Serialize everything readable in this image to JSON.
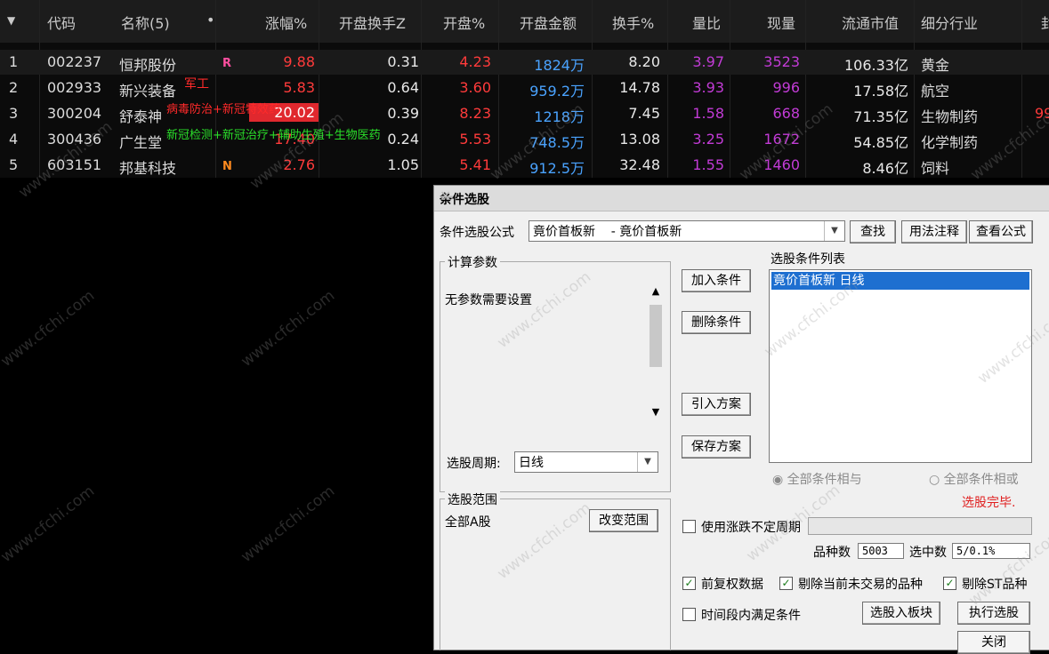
{
  "header": {
    "sort_icon": "▼",
    "cols": [
      "代码",
      "名称(5)",
      "•",
      "涨幅%",
      "开盘换手Z",
      "开盘%",
      "开盘金额",
      "换手%",
      "量比",
      "现量",
      "流通市值",
      "细分行业",
      "封"
    ]
  },
  "rows": [
    {
      "idx": "1",
      "code": "002237",
      "name": "恒邦股份",
      "tag": "R",
      "chg": "9.88",
      "open_turn": "0.31",
      "open_pct": "4.23",
      "open_amt": "1824万",
      "turn": "8.20",
      "vol_ratio": "3.97",
      "cur_vol": "3523",
      "mcap": "106.33亿",
      "industry": "黄金"
    },
    {
      "idx": "2",
      "code": "002933",
      "name": "新兴装备",
      "tag": "",
      "chg": "5.83",
      "open_turn": "0.64",
      "open_pct": "3.60",
      "open_amt": "959.2万",
      "turn": "14.78",
      "vol_ratio": "3.93",
      "cur_vol": "996",
      "mcap": "17.58亿",
      "industry": "航空"
    },
    {
      "idx": "3",
      "code": "300204",
      "name": "舒泰神",
      "tag": "",
      "chg": "20.02",
      "open_turn": "0.39",
      "open_pct": "8.23",
      "open_amt": "1218万",
      "turn": "7.45",
      "vol_ratio": "1.58",
      "cur_vol": "668",
      "mcap": "71.35亿",
      "industry": "生物制药",
      "extra": "99"
    },
    {
      "idx": "4",
      "code": "300436",
      "name": "广生堂",
      "tag": "",
      "chg": "17.40",
      "open_turn": "0.24",
      "open_pct": "5.53",
      "open_amt": "748.5万",
      "turn": "13.08",
      "vol_ratio": "3.25",
      "cur_vol": "1672",
      "mcap": "54.85亿",
      "industry": "化学制药"
    },
    {
      "idx": "5",
      "code": "603151",
      "name": "邦基科技",
      "tag": "N",
      "chg": "2.76",
      "open_turn": "1.05",
      "open_pct": "5.41",
      "open_amt": "912.5万",
      "turn": "32.48",
      "vol_ratio": "1.55",
      "cur_vol": "1460",
      "mcap": "8.46亿",
      "industry": "饲料"
    }
  ],
  "overlays": {
    "tag_junggong": "军工",
    "tag_virus": "病毒防治+新冠特效药",
    "tag_covid": "新冠检测+新冠治疗+辅助生殖+生物医药"
  },
  "dialog": {
    "title": "条件选股",
    "formula_label": "条件选股公式",
    "formula_value": "竟价首板新    - 竟价首板新",
    "find_btn": "查找",
    "usage_btn": "用法注释",
    "view_btn": "查看公式",
    "params_group": "计算参数",
    "params_text": "无参数需要设置",
    "period_label": "选股周期:",
    "period_value": "日线",
    "add_btn": "加入条件",
    "del_btn": "删除条件",
    "import_btn": "引入方案",
    "save_btn": "保存方案",
    "list_label": "选股条件列表",
    "list_item": "竟价首板新  日线",
    "radio_and": "全部条件相与",
    "radio_or": "全部条件相或",
    "status": "选股完毕.",
    "scope_group": "选股范围",
    "scope_text": "全部A股",
    "change_scope_btn": "改变范围",
    "use_uncertain": "使用涨跌不定周期",
    "count_label": "品种数",
    "count_value": "5003",
    "selected_label": "选中数",
    "selected_value": "5/0.1%",
    "fq_label": "前复权数据",
    "skip_label": "剔除当前未交易的品种",
    "st_label": "剔除ST品种",
    "period_cond": "时间段内满足条件",
    "to_block_btn": "选股入板块",
    "run_btn": "执行选股",
    "close_btn": "关闭"
  },
  "watermark": "www.cfchi.com"
}
